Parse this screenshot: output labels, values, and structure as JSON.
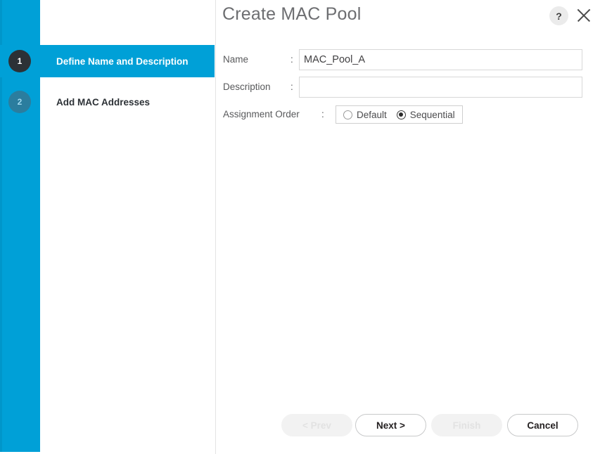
{
  "dialog": {
    "title": "Create MAC Pool",
    "help_icon": "question-mark-icon",
    "close_icon": "close-icon",
    "help_glyph": "?"
  },
  "nav": {
    "steps": [
      {
        "number": "1",
        "label": "Define Name and Description",
        "state": "active"
      },
      {
        "number": "2",
        "label": "Add MAC Addresses",
        "state": "idle"
      }
    ]
  },
  "form": {
    "name": {
      "label": "Name",
      "colon": ":",
      "value": "MAC_Pool_A",
      "placeholder": ""
    },
    "description": {
      "label": "Description",
      "colon": ":",
      "value": "",
      "placeholder": ""
    },
    "assignment_order": {
      "label": "Assignment Order",
      "colon": ":",
      "options": [
        {
          "label": "Default",
          "selected": false
        },
        {
          "label": "Sequential",
          "selected": true
        }
      ],
      "selected_value": "Sequential"
    }
  },
  "footer": {
    "prev_label": "< Prev",
    "next_label": "Next >",
    "finish_label": "Finish",
    "cancel_label": "Cancel"
  },
  "colors": {
    "accent_blue": "#00a0d7",
    "step_active_badge": "#2c3136",
    "step_idle_badge": "#2b7d9e",
    "title_gray": "#6d6e71",
    "border_gray": "#d8d8d8"
  }
}
